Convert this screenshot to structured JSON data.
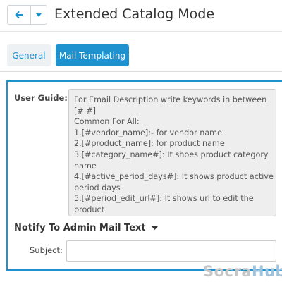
{
  "header": {
    "title": "Extended Catalog Mode",
    "back_icon": "arrow-left-icon",
    "caret_icon": "caret-down-icon",
    "accent_color": "#1e91cf"
  },
  "tabs": [
    {
      "label": "General",
      "active": false
    },
    {
      "label": "Mail Templating",
      "active": true
    }
  ],
  "user_guide": {
    "label": "User Guide:",
    "lines": [
      "For Email Description write keywords in between",
      "[# #]",
      "Common For All:",
      "1.[#vendor_name]:- for vendor name",
      "2.[#product_name]: for product name",
      "3.[#category_name#]: It shoes product category",
      "name",
      "4.[#active_period_days#]: It shows product active",
      "period days",
      "5.[#period_edit_url#]: It shows url to edit the",
      "product"
    ]
  },
  "notify_section": {
    "heading": "Notify To Admin Mail Text",
    "caret_icon": "caret-down-icon"
  },
  "subject": {
    "label": "Subject:",
    "value": "",
    "placeholder": ""
  },
  "watermark": {
    "part1": "Socra",
    "part2": "Hub"
  }
}
